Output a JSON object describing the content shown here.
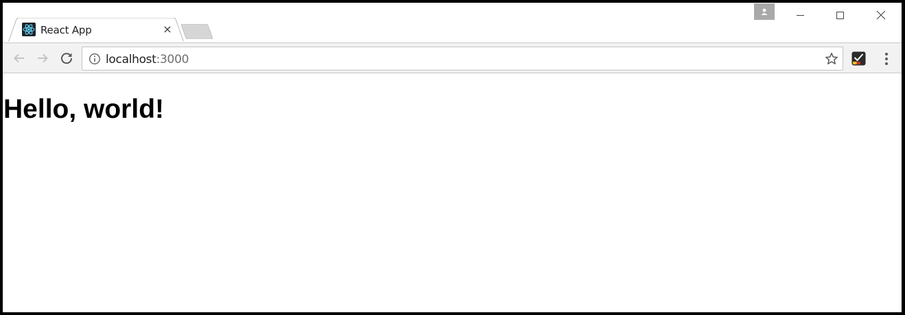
{
  "tab": {
    "title": "React App",
    "close_glyph": "×",
    "favicon_icon": "react-logo-icon"
  },
  "window_controls": {
    "profile_icon": "person-icon",
    "minimize_icon": "minimize-icon",
    "maximize_icon": "maximize-icon",
    "close_icon": "close-icon"
  },
  "toolbar": {
    "back_icon": "arrow-left-icon",
    "forward_icon": "arrow-right-icon",
    "reload_icon": "reload-icon",
    "info_icon": "info-icon",
    "url_host": "localhost",
    "url_port": ":3000",
    "bookmark_icon": "star-icon",
    "extension_icon": "checkbox-extension-icon",
    "menu_icon": "kebab-menu-icon"
  },
  "page": {
    "heading": "Hello, world!"
  },
  "colors": {
    "window_border": "#000000",
    "toolbar_bg": "#f2f2f2",
    "favicon_bg": "#20232a",
    "react_cyan": "#61dafb",
    "profile_bg": "#a9a9a9"
  }
}
